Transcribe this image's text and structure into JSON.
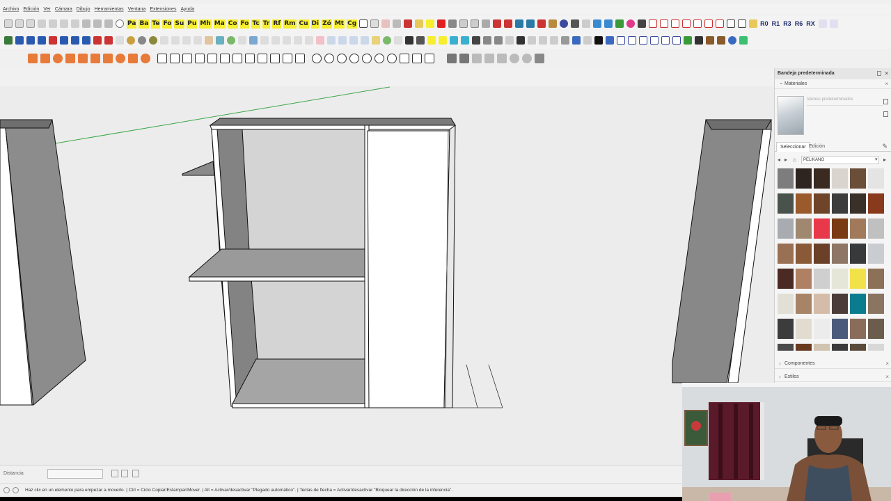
{
  "menu": [
    "Archivo",
    "Edición",
    "Ver",
    "Cámara",
    "Dibujo",
    "Herramientas",
    "Ventana",
    "Extensiones",
    "Ayuda"
  ],
  "toolbar": {
    "plugin_tags": [
      "Pa",
      "Ba",
      "Te",
      "Fo",
      "Su",
      "Pu",
      "Mh",
      "Ma",
      "Co",
      "Fo",
      "Tc",
      "Tr",
      "Rf",
      "Rm",
      "Cu",
      "Di",
      "Zó",
      "Mt",
      "Cg"
    ],
    "rotation_tags": [
      "R0",
      "R1",
      "R3",
      "R6",
      "RX"
    ],
    "accent_yellow": "#f6ee2e",
    "accent_red": "#e02020"
  },
  "tray": {
    "title": "Bandeja predeterminada",
    "materials_header": "Materiales",
    "material_name": "Valores predeterminados",
    "tab_select": "Seleccionar",
    "tab_edit": "Edición",
    "library": "PELIKANO",
    "swatches": [
      "#7d7d7d",
      "#2e2420",
      "#3a2a20",
      "#d9d4ce",
      "#6b4e38",
      "#e4e4e4",
      "#4a524c",
      "#9a5a2c",
      "#6e4528",
      "#3c3c3c",
      "#3a302a",
      "#8a3a1c",
      "#a8abb0",
      "#a08870",
      "#e8394a",
      "#7a3a14",
      "#a07a5a",
      "#c0c0c0",
      "#9a7054",
      "#8a5a38",
      "#6a4028",
      "#8e7666",
      "#38393b",
      "#c9ccd0",
      "#4a2a22",
      "#b08064",
      "#cfcfcf",
      "#e6e6d8",
      "#f2e24a",
      "#8c7058",
      "#e0e0d6",
      "#a88466",
      "#d4bca8",
      "#4a3c38",
      "#0a7c8e",
      "#8a7462",
      "#3c3c3c",
      "#e2dcd0",
      "#ececec",
      "#4a5a7a",
      "#8a6c5a",
      "#6c5c4c",
      "#4a4a4a",
      "#6a3a20",
      "#d0c4b0",
      "#3a3a3a",
      "#5a4a3a",
      "#d8d8d8"
    ],
    "components_header": "Componentes",
    "styles_header": "Estilos"
  },
  "measure": {
    "label": "Distancia",
    "value": ""
  },
  "status": {
    "hint": "Haz clic en un elemento para empezar a moverlo. | Ctrl = Ciclo Copiar/Estampar/Mover. | Alt = Activar/desactivar \"Plegado automático\". | Teclas de flecha = Activar/desactivar \"Bloquear la dirección de la inferencia\"."
  },
  "colors": {
    "panel_gray": "#8c8c8c",
    "panel_dark": "#6e6e6e",
    "door_white": "#ffffff",
    "axis_green": "#3aa648"
  }
}
